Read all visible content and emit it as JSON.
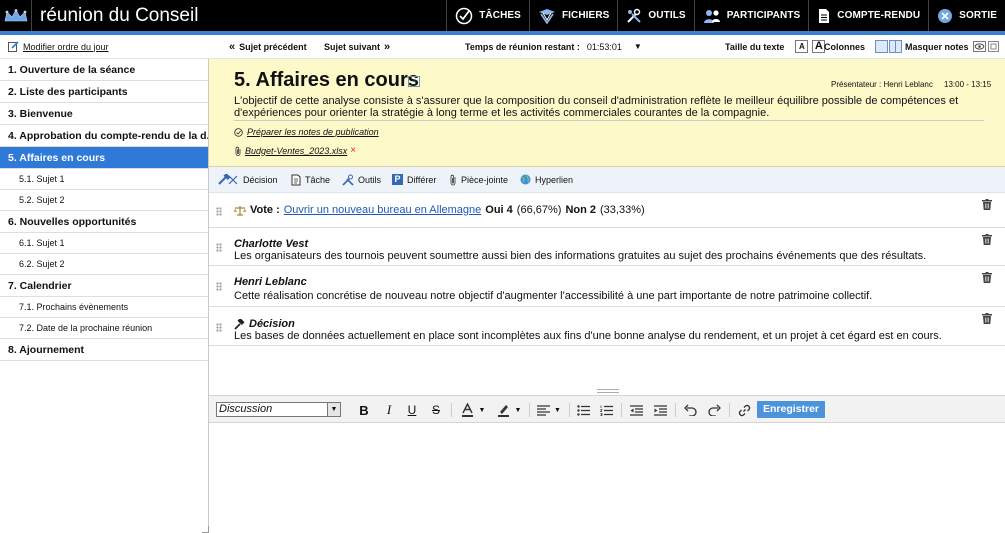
{
  "app": {
    "title": "réunion du Conseil",
    "logo_icon": "crown-icon"
  },
  "nav": [
    {
      "label": "TÂCHES",
      "icon": "check-circle-icon"
    },
    {
      "label": "FICHIERS",
      "icon": "globe-icon"
    },
    {
      "label": "OUTILS",
      "icon": "tools-icon"
    },
    {
      "label": "PARTICIPANTS",
      "icon": "people-icon"
    },
    {
      "label": "COMPTE-RENDU",
      "icon": "document-icon"
    },
    {
      "label": "SORTIE",
      "icon": "close-circle-icon"
    }
  ],
  "toolbar": {
    "edit_agenda": "Modifier ordre du jour",
    "prev_subject": "Sujet précédent",
    "next_subject": "Sujet suivant",
    "time_label": "Temps de réunion restant :",
    "time_value": "01:53:01",
    "text_size_label": "Taille du texte",
    "text_size_small": "A",
    "text_size_large": "A",
    "columns_label": "Colonnes",
    "hide_notes_label": "Masquer notes"
  },
  "sidebar": {
    "items": [
      {
        "label": "1. Ouverture de la séance",
        "level": 1,
        "active": false
      },
      {
        "label": "2. Liste des participants",
        "level": 1,
        "active": false
      },
      {
        "label": "3. Bienvenue",
        "level": 1,
        "active": false
      },
      {
        "label": "4. Approbation du compte-rendu de la d...",
        "level": 1,
        "active": false
      },
      {
        "label": "5. Affaires en cours",
        "level": 1,
        "active": true
      },
      {
        "label": "5.1. Sujet 1",
        "level": 2,
        "active": false
      },
      {
        "label": "5.2. Sujet 2",
        "level": 2,
        "active": false
      },
      {
        "label": "6. Nouvelles opportunités",
        "level": 1,
        "active": false
      },
      {
        "label": "6.1. Sujet 1",
        "level": 2,
        "active": false
      },
      {
        "label": "6.2. Sujet 2",
        "level": 2,
        "active": false
      },
      {
        "label": "7. Calendrier",
        "level": 1,
        "active": false
      },
      {
        "label": "7.1. Prochains évènements",
        "level": 2,
        "active": false
      },
      {
        "label": "7.2. Date de la prochaine réunion",
        "level": 2,
        "active": false
      },
      {
        "label": "8. Ajournement",
        "level": 1,
        "active": false
      }
    ]
  },
  "agenda": {
    "title": "5. Affaires en cours",
    "collapse_symbol": "−",
    "presenter": "Présentateur : Henri Leblanc",
    "time_range": "13:00 - 13:15",
    "description": "L'objectif de cette analyse consiste à s'assurer que la composition du conseil d'administration reflète le meilleur équilibre possible de compétences et d'expériences pour orienter la stratégie à long terme et les activités commerciales courantes de la compagnie.",
    "prep_link": "Préparer les notes de publication",
    "attachment": "Budget-Ventes_2023.xlsx",
    "remove_symbol": "×"
  },
  "actions": [
    {
      "label": "Décision",
      "icon": "gavel-icon"
    },
    {
      "label": "Tâche",
      "icon": "task-icon"
    },
    {
      "label": "Outils",
      "icon": "tools-icon"
    },
    {
      "label": "Différer",
      "icon": "defer-icon"
    },
    {
      "label": "Pièce-jointe",
      "icon": "paperclip-icon"
    },
    {
      "label": "Hyperlien",
      "icon": "globe-icon"
    }
  ],
  "entries": {
    "vote": {
      "label": "Vote :",
      "link": "Ouvrir un nouveau bureau en Allemagne",
      "yes_label": "Oui 4",
      "yes_pct": "(66,67%)",
      "no_label": "Non 2",
      "no_pct": "(33,33%)"
    },
    "comment1": {
      "author": "Charlotte Vest",
      "text": "Les organisateurs des tournois peuvent soumettre aussi bien des informations gratuites au sujet des prochains événements que des résultats."
    },
    "comment2": {
      "author": "Henri Leblanc",
      "text": "Cette réalisation concrétise de nouveau notre objectif d'augmenter l'accessibilité à une part importante de notre patrimoine collectif."
    },
    "decision": {
      "label": "Décision",
      "text": "Les bases de données actuellement en place sont incomplètes aux fins d'une bonne analyse du rendement, et un projet à cet égard est en cours."
    }
  },
  "editor": {
    "type_value": "Discussion",
    "save_label": "Enregistrer"
  },
  "colors": {
    "accent": "#2f7ad6",
    "header_bg": "#000000",
    "agenda_bg": "#fdf9c9",
    "save_bg": "#4d93d9"
  }
}
